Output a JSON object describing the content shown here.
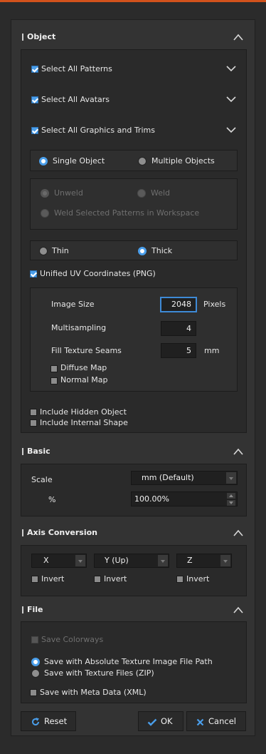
{
  "object": {
    "title": "Object",
    "select_patterns": "Select All Patterns",
    "select_avatars": "Select All Avatars",
    "select_graphics": "Select All Graphics and Trims",
    "single_object": "Single Object",
    "multiple_objects": "Multiple Objects",
    "unweld": "Unweld",
    "weld": "Weld",
    "weld_selected": "Weld Selected Patterns in Workspace",
    "thin": "Thin",
    "thick": "Thick",
    "unified_uv": "Unified UV Coordinates (PNG)",
    "image_size_label": "Image Size",
    "image_size_value": "2048",
    "image_size_unit": "Pixels",
    "multisampling_label": "Multisampling",
    "multisampling_value": "4",
    "fill_seams_label": "Fill Texture Seams",
    "fill_seams_value": "5",
    "fill_seams_unit": "mm",
    "diffuse_map": "Diffuse Map",
    "normal_map": "Normal Map",
    "include_hidden": "Include Hidden Object",
    "include_internal": "Include Internal Shape"
  },
  "basic": {
    "title": "Basic",
    "scale_label": "Scale",
    "scale_value": "mm (Default)",
    "percent_label": "%",
    "percent_value": "100.00%"
  },
  "axis": {
    "title": "Axis Conversion",
    "x": "X",
    "y": "Y (Up)",
    "z": "Z",
    "invert": "Invert"
  },
  "file": {
    "title": "File",
    "save_colorways": "Save Colorways",
    "save_absolute": "Save with Absolute Texture Image File Path",
    "save_zip": "Save with Texture Files (ZIP)",
    "save_meta": "Save with Meta Data (XML)"
  },
  "buttons": {
    "reset": "Reset",
    "ok": "OK",
    "cancel": "Cancel"
  },
  "colors": {
    "accent": "#4a9eea",
    "top_bar": "#d2521c",
    "ok_check": "#4a9eea",
    "cancel_x": "#4a9eea"
  }
}
